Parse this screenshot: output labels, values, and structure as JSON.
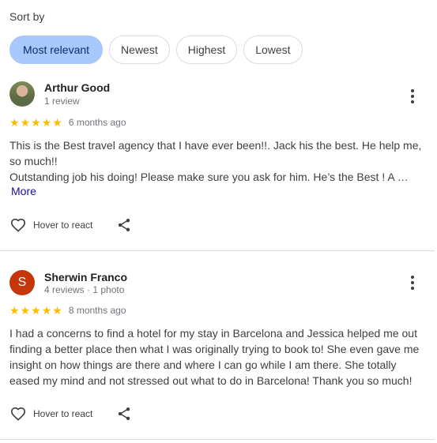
{
  "sort": {
    "label": "Sort by",
    "options": [
      {
        "label": "Most relevant",
        "active": true
      },
      {
        "label": "Newest",
        "active": false
      },
      {
        "label": "Highest",
        "active": false
      },
      {
        "label": "Lowest",
        "active": false
      }
    ]
  },
  "colors": {
    "active_chip": "#a8c7fa",
    "star": "#fbbc04",
    "avatar_s": "#c5360b",
    "link": "#1a0dab"
  },
  "reviews": [
    {
      "name": "Arthur Good",
      "meta": "1 review",
      "avatar": "photo",
      "rating": 5,
      "date": "6 months ago",
      "text": "This is the Best travel agency that I have ever been!!. Jack his the best. He help me, so much!!\nOutstanding job his doing! Please make sure you ask for him. He’s the Best ! A …",
      "more_label": "More",
      "react_label": "Hover to react"
    },
    {
      "name": "Sherwin Franco",
      "meta": "4 reviews · 1 photo",
      "avatar": "letter",
      "avatar_letter": "S",
      "rating": 5,
      "date": "8 months ago",
      "text": "I had a concerns to find a hotel for my stay in Barcelona and Jessica helped me out finding a better place then what I was originally trying to book to! She even gave me insight on how things are there and where I can go while I am there. She totally eased my mind and not stressed out what to do in Barcelona! Thank you so much!",
      "react_label": "Hover to react"
    }
  ]
}
